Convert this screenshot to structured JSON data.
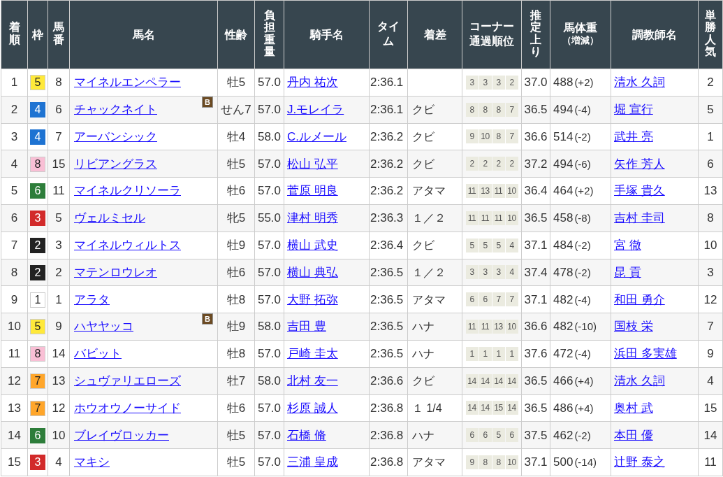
{
  "columns": [
    {
      "kind": "vertical",
      "label": "着順"
    },
    {
      "kind": "plain",
      "label": "枠"
    },
    {
      "kind": "vertical",
      "label": "馬番"
    },
    {
      "kind": "plain",
      "label": "馬名"
    },
    {
      "kind": "plain",
      "label": "性齢"
    },
    {
      "kind": "vertical",
      "label": "負担重量"
    },
    {
      "kind": "plain",
      "label": "騎手名"
    },
    {
      "kind": "lines",
      "lines": [
        "タイ",
        "ム"
      ]
    },
    {
      "kind": "plain",
      "label": "着差"
    },
    {
      "kind": "lines",
      "lines": [
        "コーナー",
        "通過順位"
      ]
    },
    {
      "kind": "vertical",
      "label": "推定上り"
    },
    {
      "kind": "note",
      "label": "馬体重",
      "note": "（増減）"
    },
    {
      "kind": "plain",
      "label": "調教師名"
    },
    {
      "kind": "vertical",
      "label": "単勝人気"
    }
  ],
  "rows": [
    {
      "rank": "1",
      "frame": {
        "number": "5",
        "color": "#ffe93a"
      },
      "num": "8",
      "name": "マイネルエンペラー",
      "sex_age": "牡5",
      "weight": "57.0",
      "jockey": "丹内 祐次",
      "time": "2:36.1",
      "corners": [
        "3",
        "3",
        "3",
        "2"
      ],
      "last3f": "37.0",
      "body_weight": "488",
      "change": "(+2)",
      "trainer": "清水 久詞",
      "popularity": "2"
    },
    {
      "rank": "2",
      "frame": {
        "number": "4",
        "color": "#1e73d2"
      },
      "num": "6",
      "name": "チャックネイト",
      "blinker": "B",
      "sex_age": "せん7",
      "weight": "57.0",
      "jockey": "J.モレイラ",
      "time": "2:36.1",
      "margin": "クビ",
      "corners": [
        "8",
        "8",
        "8",
        "7"
      ],
      "last3f": "36.5",
      "body_weight": "494",
      "change": "(-4)",
      "trainer": "堀 宣行",
      "popularity": "5"
    },
    {
      "rank": "3",
      "frame": {
        "number": "4",
        "color": "#1e73d2"
      },
      "num": "7",
      "name": "アーバンシック",
      "sex_age": "牡4",
      "weight": "58.0",
      "jockey": "C.ルメール",
      "time": "2:36.2",
      "margin": "クビ",
      "corners": [
        "9",
        "10",
        "8",
        "7"
      ],
      "last3f": "36.6",
      "body_weight": "514",
      "change": "(-2)",
      "trainer": "武井 亮",
      "popularity": "1"
    },
    {
      "rank": "4",
      "frame": {
        "number": "8",
        "color": "#f9bfd5"
      },
      "num": "15",
      "name": "リビアングラス",
      "sex_age": "牡5",
      "weight": "57.0",
      "jockey": "松山 弘平",
      "time": "2:36.2",
      "margin": "クビ",
      "corners": [
        "2",
        "2",
        "2",
        "2"
      ],
      "last3f": "37.2",
      "body_weight": "494",
      "change": "(-6)",
      "trainer": "矢作 芳人",
      "popularity": "6"
    },
    {
      "rank": "5",
      "frame": {
        "number": "6",
        "color": "#2d7d3a"
      },
      "num": "11",
      "name": "マイネルクリソーラ",
      "sex_age": "牡6",
      "weight": "57.0",
      "jockey": "菅原 明良",
      "time": "2:36.2",
      "margin": "アタマ",
      "corners": [
        "11",
        "13",
        "11",
        "10"
      ],
      "last3f": "36.4",
      "body_weight": "464",
      "change": "(+2)",
      "trainer": "手塚 貴久",
      "popularity": "13"
    },
    {
      "rank": "6",
      "frame": {
        "number": "3",
        "color": "#d22a2a"
      },
      "num": "5",
      "name": "ヴェルミセル",
      "sex_age": "牝5",
      "weight": "55.0",
      "jockey": "津村 明秀",
      "time": "2:36.3",
      "margin": "１／２",
      "corners": [
        "11",
        "11",
        "11",
        "10"
      ],
      "last3f": "36.5",
      "body_weight": "458",
      "change": "(-8)",
      "trainer": "吉村 圭司",
      "popularity": "8"
    },
    {
      "rank": "7",
      "frame": {
        "number": "2",
        "color": "#222222"
      },
      "num": "3",
      "name": "マイネルウィルトス",
      "sex_age": "牡9",
      "weight": "57.0",
      "jockey": "横山 武史",
      "time": "2:36.4",
      "margin": "クビ",
      "corners": [
        "5",
        "5",
        "5",
        "4"
      ],
      "last3f": "37.1",
      "body_weight": "484",
      "change": "(-2)",
      "trainer": "宮 徹",
      "popularity": "10"
    },
    {
      "rank": "8",
      "frame": {
        "number": "2",
        "color": "#222222"
      },
      "num": "2",
      "name": "マテンロウレオ",
      "sex_age": "牡6",
      "weight": "57.0",
      "jockey": "横山 典弘",
      "time": "2:36.5",
      "margin": "１／２",
      "corners": [
        "3",
        "3",
        "3",
        "4"
      ],
      "last3f": "37.4",
      "body_weight": "478",
      "change": "(-2)",
      "trainer": "昆 貢",
      "popularity": "3"
    },
    {
      "rank": "9",
      "frame": {
        "number": "1",
        "color": "#ffffff"
      },
      "num": "1",
      "name": "アラタ",
      "sex_age": "牡8",
      "weight": "57.0",
      "jockey": "大野 拓弥",
      "time": "2:36.5",
      "margin": "アタマ",
      "corners": [
        "6",
        "6",
        "7",
        "7"
      ],
      "last3f": "37.1",
      "body_weight": "482",
      "change": "(-4)",
      "trainer": "和田 勇介",
      "popularity": "12"
    },
    {
      "rank": "10",
      "frame": {
        "number": "5",
        "color": "#ffe93a"
      },
      "num": "9",
      "name": "ハヤヤッコ",
      "blinker": "B",
      "sex_age": "牡9",
      "weight": "58.0",
      "jockey": "吉田 豊",
      "time": "2:36.5",
      "margin": "ハナ",
      "corners": [
        "11",
        "11",
        "13",
        "10"
      ],
      "last3f": "36.6",
      "body_weight": "482",
      "change": "(-10)",
      "trainer": "国枝 栄",
      "popularity": "7"
    },
    {
      "rank": "11",
      "frame": {
        "number": "8",
        "color": "#f9bfd5"
      },
      "num": "14",
      "name": "バビット",
      "sex_age": "牡8",
      "weight": "57.0",
      "jockey": "戸崎 圭太",
      "time": "2:36.5",
      "margin": "ハナ",
      "corners": [
        "1",
        "1",
        "1",
        "1"
      ],
      "last3f": "37.6",
      "body_weight": "472",
      "change": "(-4)",
      "trainer": "浜田 多実雄",
      "popularity": "9"
    },
    {
      "rank": "12",
      "frame": {
        "number": "7",
        "color": "#ffa62b"
      },
      "num": "13",
      "name": "シュヴァリエローズ",
      "sex_age": "牡7",
      "weight": "58.0",
      "jockey": "北村 友一",
      "time": "2:36.6",
      "margin": "クビ",
      "corners": [
        "14",
        "14",
        "14",
        "14"
      ],
      "last3f": "36.5",
      "body_weight": "466",
      "change": "(+4)",
      "trainer": "清水 久詞",
      "popularity": "4"
    },
    {
      "rank": "13",
      "frame": {
        "number": "7",
        "color": "#ffa62b"
      },
      "num": "12",
      "name": "ホウオウノーサイド",
      "sex_age": "牡6",
      "weight": "57.0",
      "jockey": "杉原 誠人",
      "time": "2:36.8",
      "margin": "１ 1/4",
      "corners": [
        "14",
        "14",
        "15",
        "14"
      ],
      "last3f": "36.5",
      "body_weight": "486",
      "change": "(+4)",
      "trainer": "奥村 武",
      "popularity": "15"
    },
    {
      "rank": "14",
      "frame": {
        "number": "6",
        "color": "#2d7d3a"
      },
      "num": "10",
      "name": "ブレイヴロッカー",
      "sex_age": "牡5",
      "weight": "57.0",
      "jockey": "石橋 脩",
      "time": "2:36.8",
      "margin": "ハナ",
      "corners": [
        "6",
        "6",
        "5",
        "6"
      ],
      "last3f": "37.5",
      "body_weight": "462",
      "change": "(-2)",
      "trainer": "本田 優",
      "popularity": "14"
    },
    {
      "rank": "15",
      "frame": {
        "number": "3",
        "color": "#d22a2a"
      },
      "num": "4",
      "name": "マキシ",
      "sex_age": "牡5",
      "weight": "57.0",
      "jockey": "三浦 皇成",
      "time": "2:36.8",
      "margin": "アタマ",
      "corners": [
        "9",
        "8",
        "8",
        "10"
      ],
      "last3f": "37.1",
      "body_weight": "500",
      "change": "(-14)",
      "trainer": "辻野 泰之",
      "popularity": "11"
    }
  ]
}
